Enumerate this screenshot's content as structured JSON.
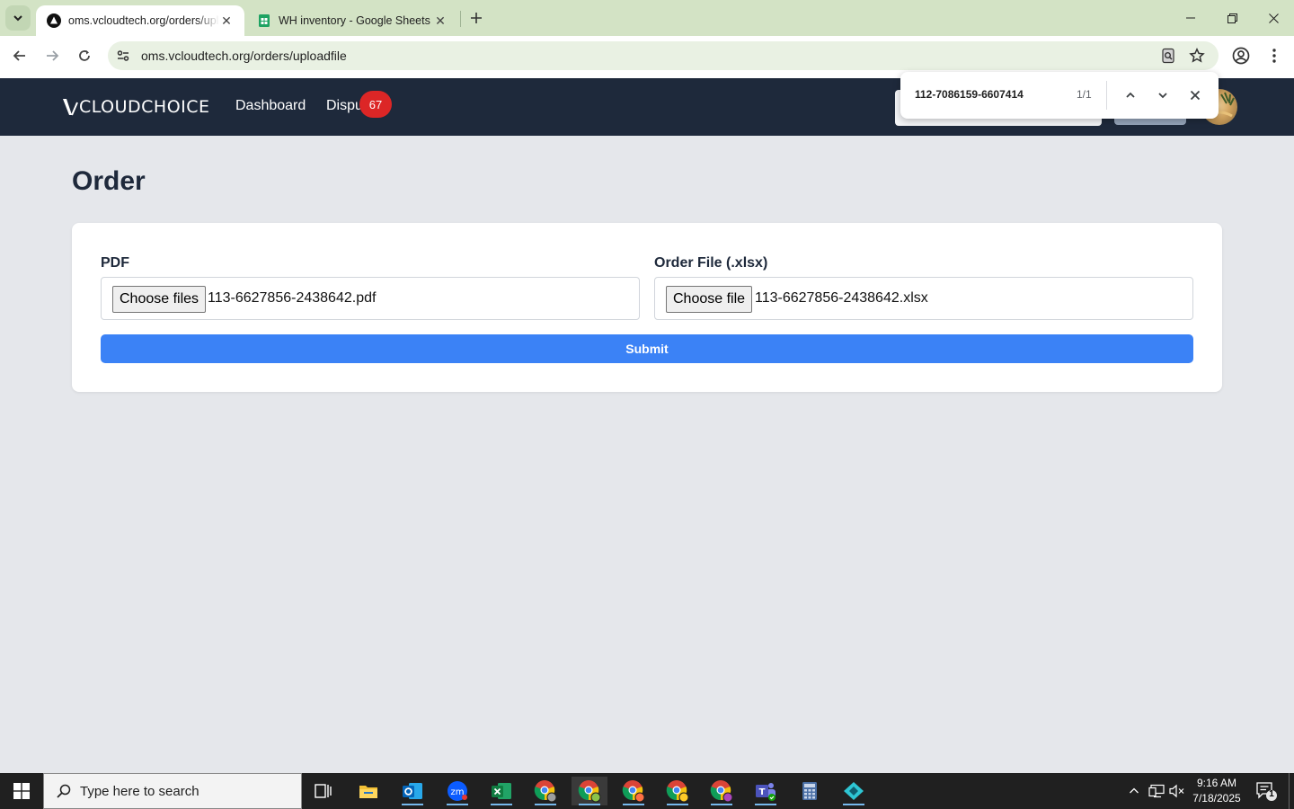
{
  "browser": {
    "tabs": [
      {
        "title": "oms.vcloudtech.org/orders/uploadfile",
        "active": true
      },
      {
        "title": "WH inventory - Google Sheets",
        "active": false
      }
    ],
    "url": "oms.vcloudtech.org/orders/uploadfile",
    "find": {
      "query": "112-7086159-6607414",
      "count": "1/1"
    }
  },
  "app": {
    "logo_text": "CLOUDCHOICE",
    "nav": [
      {
        "label": "Dashboard"
      },
      {
        "label": "Dispu"
      }
    ],
    "badge_count": "67"
  },
  "page": {
    "title": "Order",
    "pdf_field": {
      "label": "PDF",
      "button": "Choose files",
      "filename": "113-6627856-2438642.pdf"
    },
    "order_field": {
      "label": "Order File (.xlsx)",
      "button": "Choose file",
      "filename": "113-6627856-2438642.xlsx"
    },
    "submit_label": "Submit"
  },
  "taskbar": {
    "search_placeholder": "Type here to search",
    "time": "9:16 AM",
    "date": "7/18/2025",
    "notification_count": "1"
  },
  "colors": {
    "header_bg": "#1e293b",
    "submit_bg": "#3b82f6",
    "badge_bg": "#dc2626",
    "page_bg": "#e5e7eb"
  }
}
